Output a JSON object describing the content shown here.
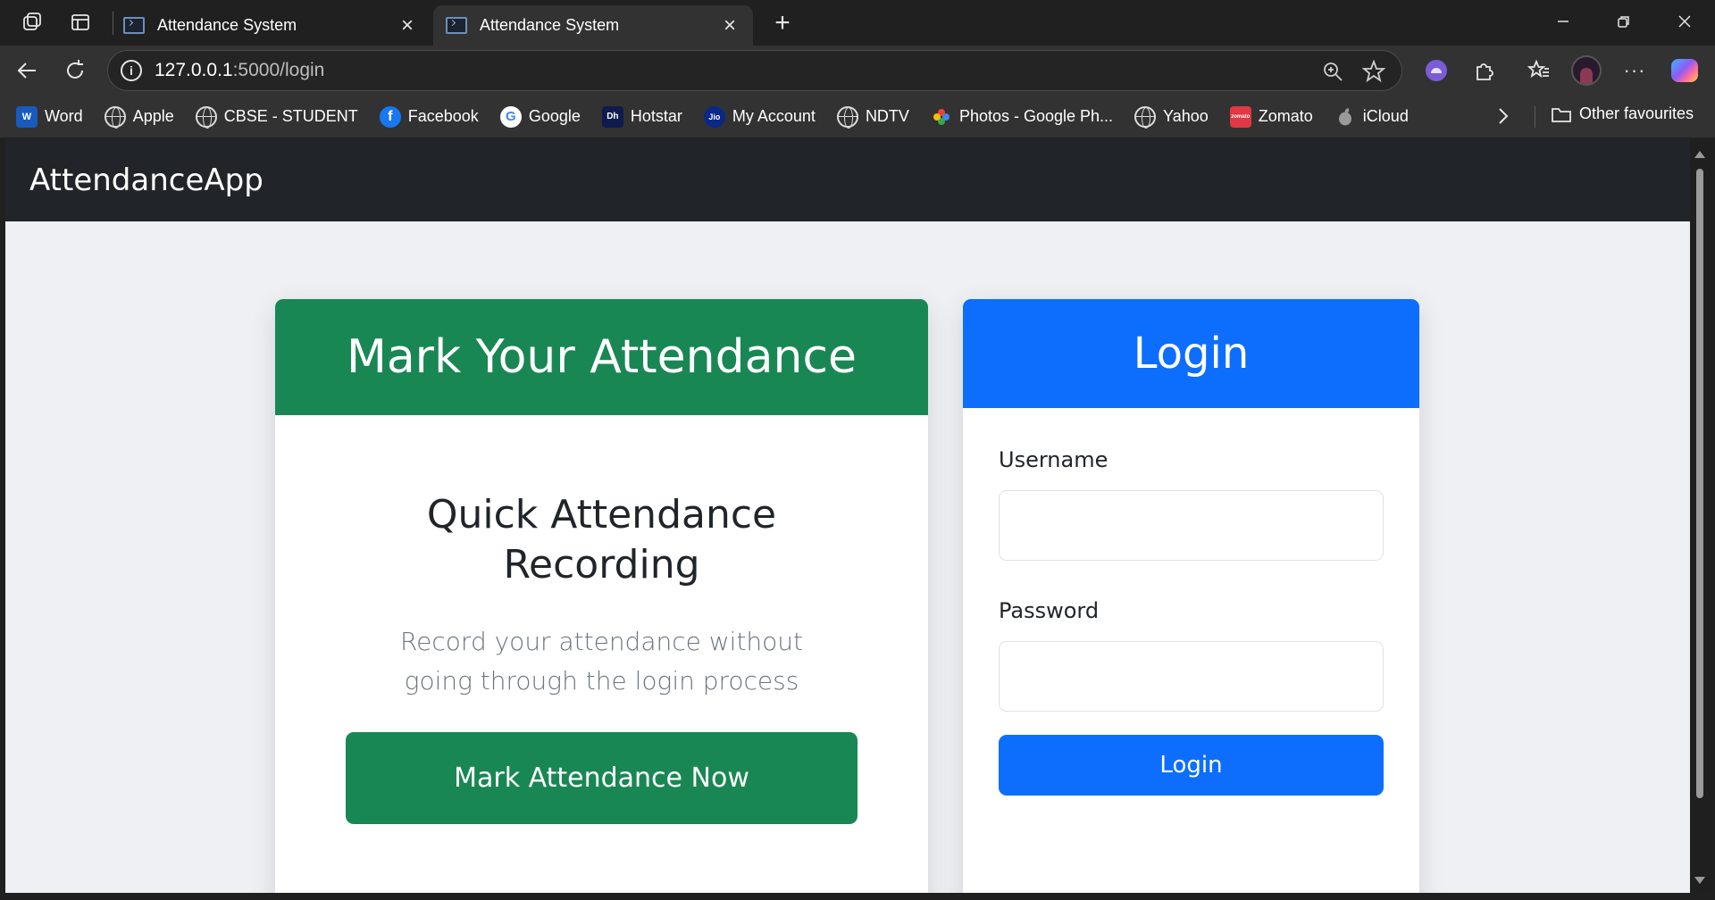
{
  "browser": {
    "tabs": [
      {
        "title": "Attendance System",
        "active": false
      },
      {
        "title": "Attendance System",
        "active": true
      }
    ],
    "address": {
      "host": "127.0.0.1",
      "path": ":5000/login"
    },
    "bookmarks": [
      {
        "label": "Word",
        "icon": "word-icon"
      },
      {
        "label": "Apple",
        "icon": "globe-icon"
      },
      {
        "label": "CBSE - STUDENT",
        "icon": "globe-icon"
      },
      {
        "label": "Facebook",
        "icon": "facebook-icon"
      },
      {
        "label": "Google",
        "icon": "google-icon"
      },
      {
        "label": "Hotstar",
        "icon": "hotstar-icon"
      },
      {
        "label": "My Account",
        "icon": "jio-icon"
      },
      {
        "label": "NDTV",
        "icon": "globe-icon"
      },
      {
        "label": "Photos - Google Ph...",
        "icon": "photos-icon"
      },
      {
        "label": "Yahoo",
        "icon": "globe-icon"
      },
      {
        "label": "Zomato",
        "icon": "zomato-icon"
      },
      {
        "label": "iCloud",
        "icon": "apple-icon"
      }
    ],
    "other_favourites": "Other favourites"
  },
  "app": {
    "brand": "AttendanceApp",
    "attendance_card": {
      "header": "Mark Your Attendance",
      "heading": "Quick Attendance Recording",
      "description": "Record your attendance without going through the login process",
      "button": "Mark Attendance Now"
    },
    "login_card": {
      "header": "Login",
      "username_label": "Username",
      "username_value": "",
      "password_label": "Password",
      "password_value": "",
      "button": "Login"
    }
  },
  "colors": {
    "navbar": "#212529",
    "success": "#198754",
    "primary": "#0d6efd",
    "page_bg": "#eef0f4"
  }
}
